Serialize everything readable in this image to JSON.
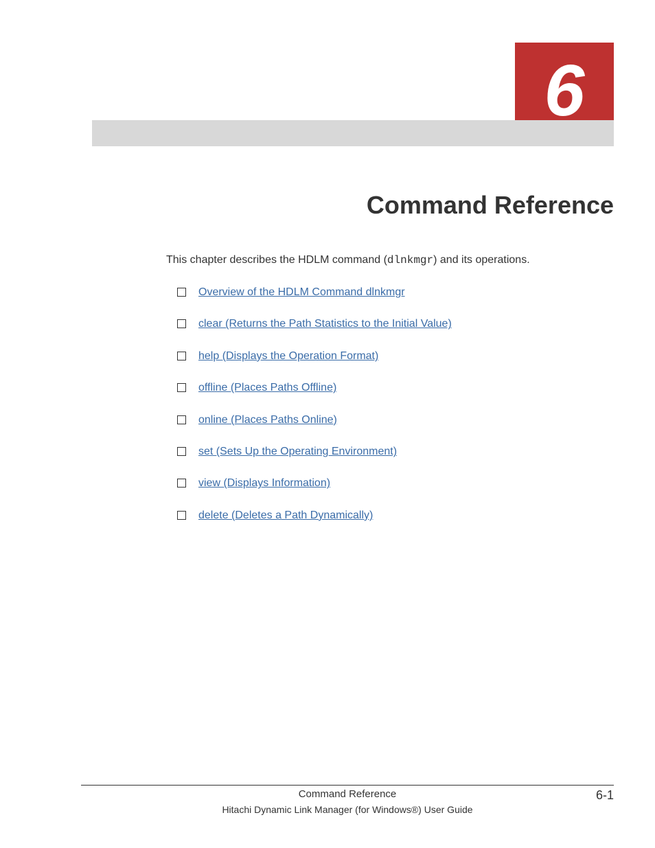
{
  "chapter_number": "6",
  "page_title": "Command Reference",
  "intro": {
    "prefix": "This chapter describes the HDLM command (",
    "code": "dlnkmgr",
    "suffix": ") and its operations."
  },
  "toc_items": [
    {
      "label": "Overview of the HDLM Command dlnkmgr"
    },
    {
      "label": "clear (Returns the Path Statistics to the Initial Value)"
    },
    {
      "label": "help (Displays the Operation Format)"
    },
    {
      "label": "offline (Places Paths Offline)"
    },
    {
      "label": "online (Places Paths Online)"
    },
    {
      "label": "set (Sets Up the Operating Environment)"
    },
    {
      "label": "view (Displays Information)"
    },
    {
      "label": "delete (Deletes a Path Dynamically)"
    }
  ],
  "footer": {
    "section": "Command Reference",
    "guide": "Hitachi Dynamic Link Manager (for Windows®) User Guide",
    "page_number": "6-1"
  }
}
